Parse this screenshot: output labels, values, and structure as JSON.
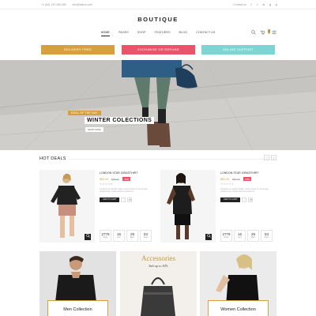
{
  "topbar": {
    "phone": "+1 (54) 123 456 456",
    "email": "info@tiamo.com",
    "contact": "Contact us",
    "social": [
      "f",
      "t",
      "in",
      "g",
      "p"
    ]
  },
  "brand": {
    "logo": "BOUTIQUE"
  },
  "nav": {
    "items": [
      "HOME",
      "PAGES",
      "SHOP",
      "FEATURES",
      "BLOG",
      "CONTACT US"
    ],
    "cart_count": "0"
  },
  "promos": [
    "DELIVERY FREE",
    "EXCHANGE OR REFUND",
    "ONLINE SUPPORT"
  ],
  "hero": {
    "badge": "DEAL OF THE DAY",
    "title": "WINTER COLECTIONS",
    "button": "SHOP NOW"
  },
  "hot_deals": {
    "title": "HOT DEALS",
    "prev": "‹",
    "next": "›",
    "products": [
      {
        "name": "LONDON STAR GIRASTHIRT",
        "price": "$80.00",
        "old_price": "$90.00",
        "discount": "-10%",
        "stars": "★★★★★",
        "desc": "Contrary to popular belief, Lorem Ipsum is not simply random text. It has roots in a piece of",
        "cart": "ADD TO CART",
        "timer": [
          {
            "value": "2779",
            "label": "Days"
          },
          {
            "value": "16",
            "label": "Hrs"
          },
          {
            "value": "29",
            "label": "Mins"
          },
          {
            "value": "53",
            "label": "Secs"
          }
        ]
      },
      {
        "name": "LONDON STAR GIRASTHIRT",
        "price": "$80.00",
        "old_price": "$90.00",
        "discount": "-10%",
        "stars": "★★★★★",
        "desc": "Contrary to popular belief, Lorem Ipsum is not simply random text. It has roots in a piece of",
        "cart": "ADD TO CART",
        "timer": [
          {
            "value": "2779",
            "label": "Days"
          },
          {
            "value": "16",
            "label": "Hrs"
          },
          {
            "value": "29",
            "label": "Mins"
          },
          {
            "value": "53",
            "label": "Secs"
          }
        ]
      }
    ]
  },
  "collections": {
    "men": "Men Collection",
    "accessories_title": "Accessories",
    "accessories_sub": "Sale up to 30%",
    "women": "Women Collection"
  },
  "colors": {
    "gold": "#d4a040",
    "pink": "#e8546a",
    "teal": "#7fd3d3",
    "dark": "#222222"
  }
}
